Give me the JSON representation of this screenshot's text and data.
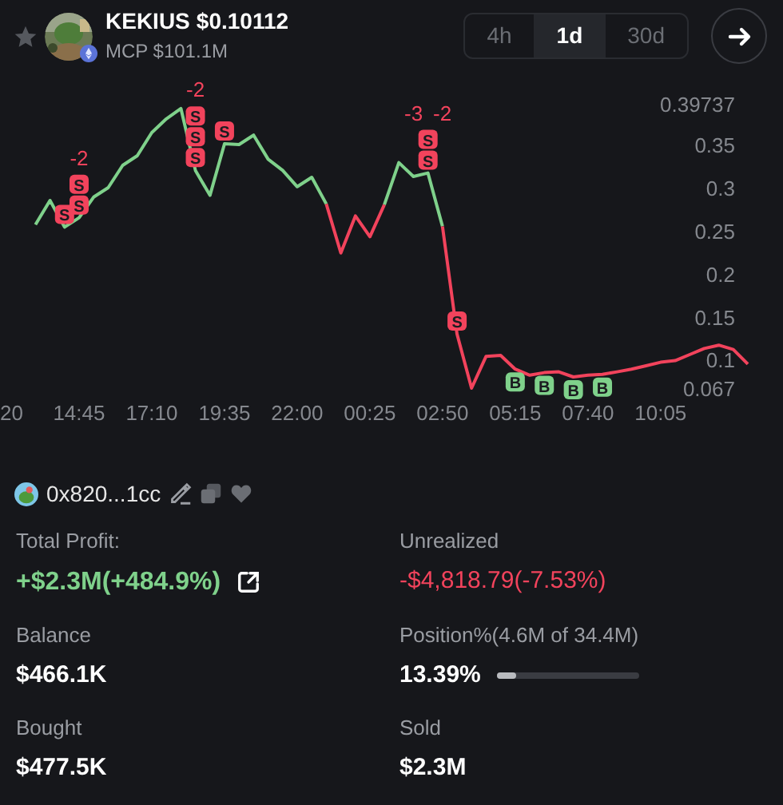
{
  "header": {
    "token_name": "KEKIUS",
    "price": "$0.10112",
    "market_cap": "MCP $101.1M",
    "starred": false
  },
  "timeframes": [
    {
      "label": "4h",
      "selected": false
    },
    {
      "label": "1d",
      "selected": true
    },
    {
      "label": "30d",
      "selected": false
    }
  ],
  "chart": {
    "chart_data": {
      "type": "line",
      "categories": [
        "20",
        null,
        null,
        null,
        null,
        "14:45",
        null,
        null,
        null,
        null,
        "17:10",
        null,
        null,
        null,
        null,
        "19:35",
        null,
        null,
        null,
        null,
        "22:00",
        null,
        null,
        null,
        null,
        "00:25",
        null,
        null,
        null,
        null,
        "02:50",
        null,
        null,
        null,
        null,
        "05:15",
        null,
        null,
        null,
        null,
        "07:40",
        null,
        null,
        null,
        null,
        "10:05",
        null,
        null,
        null,
        null,
        null,
        null
      ],
      "series": [
        {
          "color": "#7fd18b",
          "values": [
            null,
            null,
            0.257,
            0.285,
            0.254,
            0.265,
            0.289,
            0.3,
            0.326,
            0.337,
            0.364,
            0.38,
            0.392,
            0.32,
            0.291,
            0.351,
            0.35,
            0.361,
            0.333,
            0.32,
            0.301,
            0.312,
            0.281,
            null,
            null,
            null,
            0.28,
            0.329,
            0.313,
            0.317,
            0.255,
            null,
            null,
            null,
            null,
            null,
            null,
            null,
            null,
            null,
            null,
            null,
            null,
            null,
            null,
            null,
            null,
            null,
            null,
            null,
            null,
            null
          ]
        },
        {
          "color": "#f2435c",
          "values": [
            null,
            null,
            null,
            null,
            null,
            null,
            null,
            null,
            null,
            null,
            null,
            null,
            null,
            null,
            null,
            null,
            null,
            null,
            null,
            null,
            null,
            null,
            0.281,
            0.224,
            0.267,
            0.243,
            0.28,
            null,
            null,
            null,
            0.255,
            0.13,
            0.067,
            0.104,
            0.105,
            0.089,
            0.082,
            0.085,
            0.086,
            0.08,
            0.082,
            0.083,
            0.086,
            0.089,
            0.093,
            0.097,
            0.099,
            0.106,
            0.113,
            0.117,
            0.112,
            0.095
          ]
        }
      ],
      "ylim": [
        0.067,
        0.39737
      ],
      "yticks": [
        0.39737,
        0.35,
        0.3,
        0.25,
        0.2,
        0.15,
        0.1,
        0.067
      ]
    },
    "trade_marks": {
      "4": [
        {
          "text": "S",
          "kind": "sell"
        }
      ],
      "5": [
        {
          "text": "-2",
          "kind": "count"
        },
        {
          "text": "S",
          "kind": "sell"
        },
        {
          "text": "S",
          "kind": "sell"
        }
      ],
      "13": [
        {
          "text": "-2",
          "kind": "count"
        },
        {
          "text": "S",
          "kind": "sell"
        },
        {
          "text": "S",
          "kind": "sell"
        },
        {
          "text": "S",
          "kind": "sell"
        }
      ],
      "15": [
        {
          "text": "S",
          "kind": "sell"
        }
      ],
      "29": [
        {
          "text": "-3",
          "kind": "count"
        },
        {
          "text": "-2",
          "kind": "count"
        },
        {
          "text": "S",
          "kind": "sell"
        },
        {
          "text": "S",
          "kind": "sell"
        }
      ],
      "31": [
        {
          "text": "S",
          "kind": "sell"
        }
      ],
      "35": [
        {
          "text": "B",
          "kind": "buy"
        }
      ],
      "37": [
        {
          "text": "B",
          "kind": "buy"
        }
      ],
      "39": [
        {
          "text": "B",
          "kind": "buy"
        }
      ],
      "41": [
        {
          "text": "B",
          "kind": "buy"
        }
      ]
    }
  },
  "wallet": {
    "address": "0x820...1cc"
  },
  "stats": [
    {
      "label": "Total Profit:",
      "value": "+$2.3M(+484.9%)",
      "kind": "profit"
    },
    {
      "label": "Unrealized",
      "value": "-$4,818.79(-7.53%)",
      "kind": "loss"
    },
    {
      "label": "Balance",
      "value": "$466.1K",
      "kind": "plain"
    },
    {
      "label": "Position%(4.6M of 34.4M)",
      "value": "13.39%",
      "kind": "meter",
      "level": 0.134
    },
    {
      "label": "Bought",
      "value": "$477.5K",
      "kind": "plain"
    },
    {
      "label": "Sold",
      "value": "$2.3M",
      "kind": "plain"
    }
  ]
}
